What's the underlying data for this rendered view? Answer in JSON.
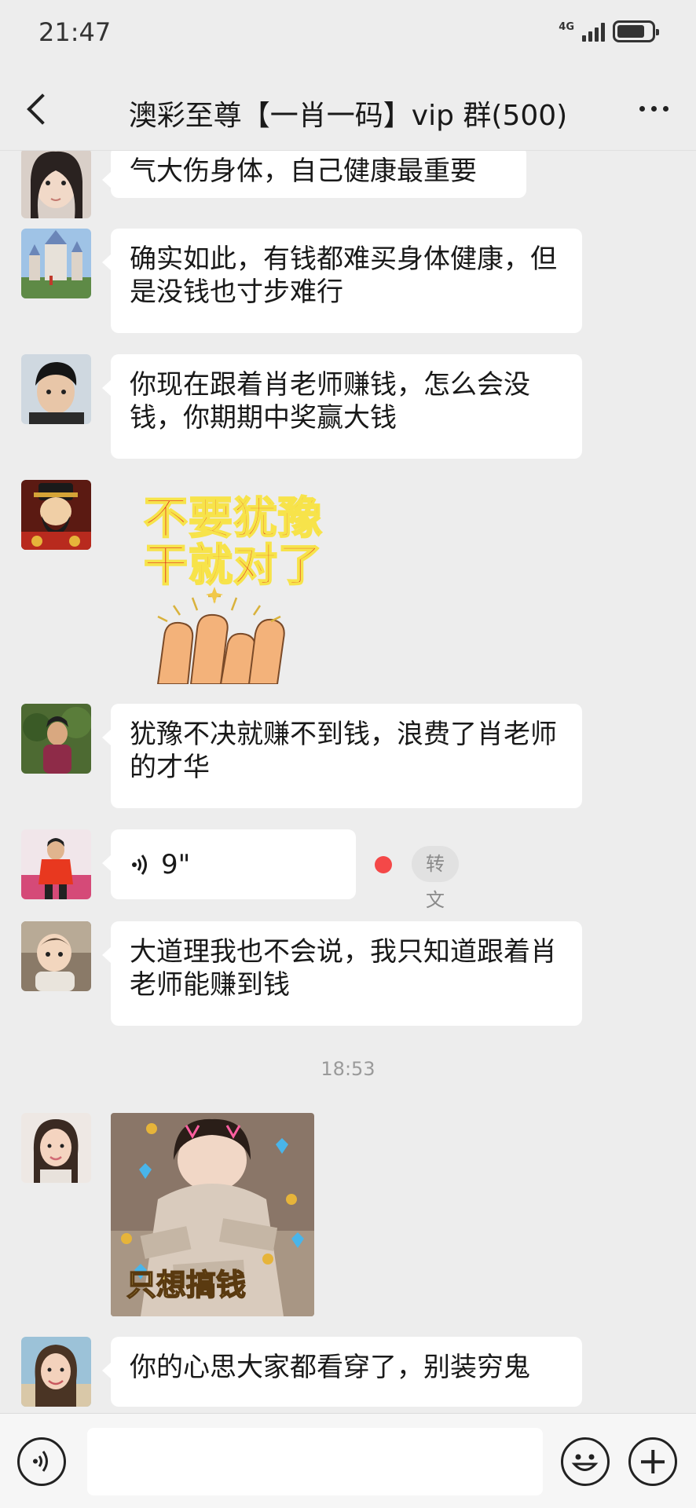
{
  "status_bar": {
    "time": "21:47",
    "network": "4G",
    "icons": [
      "signal-icon",
      "battery-icon"
    ]
  },
  "header": {
    "title": "澳彩至尊【一肖一码】vip 群(500)",
    "back_icon": "back-chevron-icon",
    "more_icon": "more-dots-icon"
  },
  "messages": [
    {
      "type": "text",
      "text": "气大伤身体，自己健康最重要",
      "avatar": "avatar-woman-portrait"
    },
    {
      "type": "text",
      "text": "确实如此，有钱都难买身体健康，但是没钱也寸步难行",
      "avatar": "avatar-castle-scene"
    },
    {
      "type": "text",
      "text": "你现在跟着肖老师赚钱，怎么会没钱，你期期中奖赢大钱",
      "avatar": "avatar-young-man"
    },
    {
      "type": "sticker",
      "line1": "不要犹豫",
      "line2": "干就对了",
      "avatar": "avatar-fortune-god"
    },
    {
      "type": "text",
      "text": "犹豫不决就赚不到钱，浪费了肖老师的才华",
      "avatar": "avatar-woman-garden"
    },
    {
      "type": "voice",
      "duration": "9\"",
      "to_text_label": "转文字",
      "avatar": "avatar-man-red-shirt"
    },
    {
      "type": "text",
      "text": "大道理我也不会说，我只知道跟着肖老师能赚到钱",
      "avatar": "avatar-baby"
    },
    {
      "type": "timestamp",
      "text": "18:53"
    },
    {
      "type": "sticker",
      "caption": "只想搞钱",
      "avatar": "avatar-woman-smiling"
    },
    {
      "type": "text",
      "text": "你的心思大家都看穿了，别装穷鬼",
      "avatar": "avatar-woman-beach"
    }
  ],
  "input_bar": {
    "voice_icon": "voice-input-icon",
    "emoji_icon": "emoji-icon",
    "plus_icon": "plus-icon",
    "input_value": ""
  },
  "colors": {
    "background": "#ededed",
    "bubble": "#ffffff",
    "unread_dot": "#f44848"
  }
}
